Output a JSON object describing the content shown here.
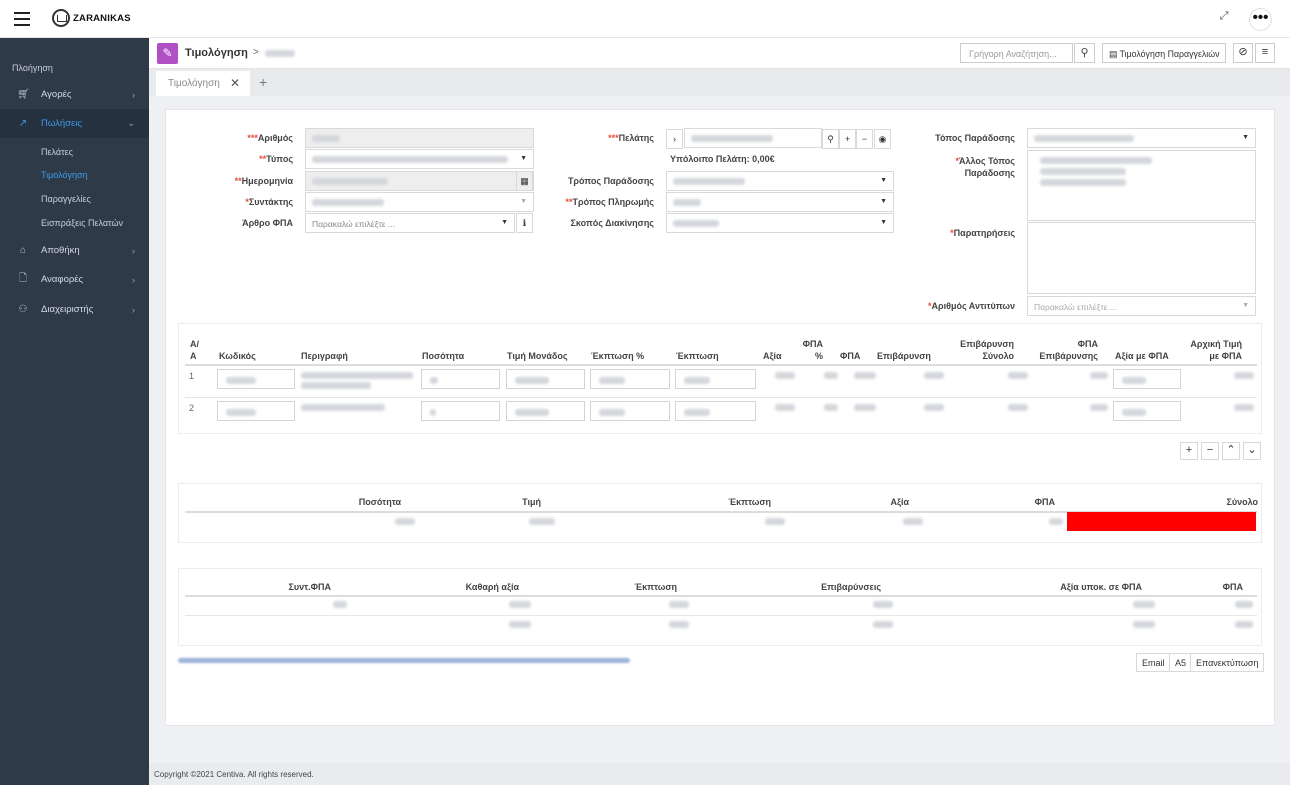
{
  "app": {
    "brand": "ZARANIKAS"
  },
  "sidebar": {
    "heading": "Πλοήγηση",
    "items": [
      {
        "label": "Αγορές",
        "icon": "cart-icon"
      },
      {
        "label": "Πωλήσεις",
        "icon": "chart-line-icon"
      },
      {
        "label": "Αποθήκη",
        "icon": "home-icon"
      },
      {
        "label": "Αναφορές",
        "icon": "file-icon"
      },
      {
        "label": "Διαχειριστής",
        "icon": "user-icon"
      }
    ],
    "subitems": [
      "Πελάτες",
      "Τιμολόγηση",
      "Παραγγελίες",
      "Εισπράξεις Πελατών"
    ]
  },
  "header": {
    "title": "Τιμολόγηση",
    "crumb_sep": ">",
    "search_placeholder": "Γρήγορη Αναζήτηση...",
    "orders_button": "Τιμολόγηση Παραγγελιών"
  },
  "tabs": [
    {
      "label": "Τιμολόγηση"
    }
  ],
  "form": {
    "left": {
      "number_label": "Αριθμός",
      "type_label": "Τύπος",
      "date_label": "Ημερομηνία",
      "author_label": "Συντάκτης",
      "vat_article_label": "Άρθρο ΦΠΑ",
      "vat_article_placeholder": "Παρακαλώ επιλέξτε ..."
    },
    "middle": {
      "customer_label": "Πελάτης",
      "balance_text": "Υπόλοιπο Πελάτη: 0,00€",
      "delivery_method_label": "Τρόπος Παράδοσης",
      "payment_method_label": "Τρόπος Πληρωμής",
      "shipment_purpose_label": "Σκοπός Διακίνησης"
    },
    "right": {
      "delivery_place_label": "Τόπος Παράδοσης",
      "other_place_label_1": "Άλλος Τόπος",
      "other_place_label_2": "Παράδοσης",
      "notes_label": "Παρατηρήσεις",
      "copies_label": "Αριθμός Αντιτύπων",
      "copies_placeholder": "Παρακαλώ επιλέξτε ..."
    }
  },
  "lines_table": {
    "headers": {
      "aa_1": "Α/",
      "aa_2": "Α",
      "code": "Κωδικός",
      "description": "Περιγραφή",
      "quantity": "Ποσότητα",
      "unit_price": "Τιμή Μονάδος",
      "discount_pct": "Έκπτωση %",
      "discount": "Έκπτωση",
      "value": "Αξία",
      "vat_pct_1": "ΦΠΑ",
      "vat_pct_2": "%",
      "vat": "ΦΠΑ",
      "surcharge": "Επιβάρυνση",
      "surcharge_total_1": "Επιβάρυνση",
      "surcharge_total_2": "Σύνολο",
      "surcharge_vat_1": "ΦΠΑ",
      "surcharge_vat_2": "Επιβάρυνσης",
      "value_with_vat": "Αξία με ΦΠΑ",
      "orig_price_1": "Αρχική Τιμή",
      "orig_price_2": "με ΦΠΑ"
    },
    "rows": [
      {
        "aa": "1"
      },
      {
        "aa": "2"
      }
    ]
  },
  "totals_table": {
    "headers": {
      "quantity": "Ποσότητα",
      "price": "Τιμή",
      "discount": "Έκπτωση",
      "value": "Αξία",
      "vat": "ΦΠΑ",
      "total": "Σύνολο"
    },
    "total_highlight_color": "#ff0000"
  },
  "vat_table": {
    "headers": {
      "vat_rate": "Συντ.ΦΠΑ",
      "net_value": "Καθαρή αξία",
      "discount": "Έκπτωση",
      "surcharges": "Επιβαρύνσεις",
      "taxable_value": "Αξία υποκ. σε ΦΠΑ",
      "vat": "ΦΠΑ"
    }
  },
  "actions": {
    "email": "Email",
    "a5": "A5",
    "reprint": "Επανεκτύπωση"
  },
  "footer": {
    "copyright": "Copyright ©2021 Centiva. All rights reserved."
  }
}
